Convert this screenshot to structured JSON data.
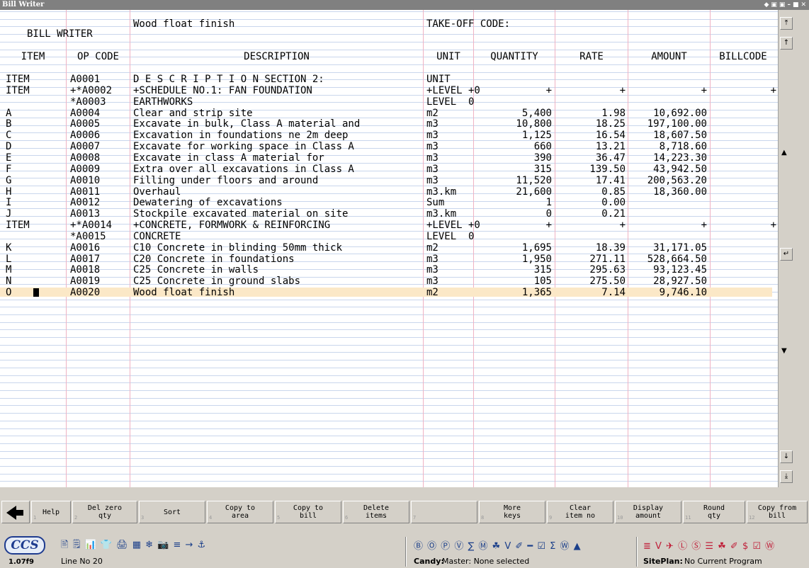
{
  "window": {
    "title": "Bill Writer",
    "controls": [
      "◆",
      "▣",
      "▣",
      "–",
      "■",
      "✕"
    ]
  },
  "sheet": {
    "app_label": "BILL WRITER",
    "current_description": "Wood float finish",
    "takeoff_label": "TAKE-OFF CODE:",
    "columns": [
      "ITEM",
      "OP CODE",
      "DESCRIPTION",
      "UNIT",
      "QUANTITY",
      "RATE",
      "AMOUNT",
      "BILLCODE"
    ],
    "rows": [
      {
        "item": "ITEM",
        "op": "A0001",
        "desc": "D E S C R I P T I O N SECTION 2:",
        "unit": "UNIT",
        "qty": "",
        "rate": "",
        "amount": "",
        "bill": ""
      },
      {
        "item": "ITEM",
        "op": "+*A0002",
        "desc": "+SCHEDULE NO.1: FAN FOUNDATION",
        "unit": "+LEVEL +0",
        "qty": "+",
        "rate": "+",
        "amount": "+",
        "bill": "+"
      },
      {
        "item": "",
        "op": "*A0003",
        "desc": "EARTHWORKS",
        "unit": "LEVEL  0",
        "qty": "",
        "rate": "",
        "amount": "",
        "bill": ""
      },
      {
        "item": "A",
        "op": "A0004",
        "desc": "Clear and strip site",
        "unit": "m2",
        "qty": "5,400",
        "rate": "1.98",
        "amount": "10,692.00",
        "bill": ""
      },
      {
        "item": "B",
        "op": "A0005",
        "desc": "Excavate in bulk, Class A material and",
        "unit": "m3",
        "qty": "10,800",
        "rate": "18.25",
        "amount": "197,100.00",
        "bill": ""
      },
      {
        "item": "C",
        "op": "A0006",
        "desc": "Excavation in foundations ne 2m deep",
        "unit": "m3",
        "qty": "1,125",
        "rate": "16.54",
        "amount": "18,607.50",
        "bill": ""
      },
      {
        "item": "D",
        "op": "A0007",
        "desc": "Excavate for working space in Class A",
        "unit": "m3",
        "qty": "660",
        "rate": "13.21",
        "amount": "8,718.60",
        "bill": ""
      },
      {
        "item": "E",
        "op": "A0008",
        "desc": "Excavate in class A material for",
        "unit": "m3",
        "qty": "390",
        "rate": "36.47",
        "amount": "14,223.30",
        "bill": ""
      },
      {
        "item": "F",
        "op": "A0009",
        "desc": "Extra over all excavations in Class A",
        "unit": "m3",
        "qty": "315",
        "rate": "139.50",
        "amount": "43,942.50",
        "bill": ""
      },
      {
        "item": "G",
        "op": "A0010",
        "desc": "Filling under floors and around",
        "unit": "m3",
        "qty": "11,520",
        "rate": "17.41",
        "amount": "200,563.20",
        "bill": ""
      },
      {
        "item": "H",
        "op": "A0011",
        "desc": "Overhaul",
        "unit": "m3.km",
        "qty": "21,600",
        "rate": "0.85",
        "amount": "18,360.00",
        "bill": ""
      },
      {
        "item": "I",
        "op": "A0012",
        "desc": "Dewatering of excavations",
        "unit": "Sum",
        "qty": "1",
        "rate": "0.00",
        "amount": "",
        "bill": ""
      },
      {
        "item": "J",
        "op": "A0013",
        "desc": "Stockpile excavated material on site",
        "unit": "m3.km",
        "qty": "0",
        "rate": "0.21",
        "amount": "",
        "bill": ""
      },
      {
        "item": "ITEM",
        "op": "+*A0014",
        "desc": "+CONCRETE, FORMWORK & REINFORCING",
        "unit": "+LEVEL +0",
        "qty": "+",
        "rate": "+",
        "amount": "+",
        "bill": "+"
      },
      {
        "item": "",
        "op": "*A0015",
        "desc": "CONCRETE",
        "unit": "LEVEL  0",
        "qty": "",
        "rate": "",
        "amount": "",
        "bill": ""
      },
      {
        "item": "K",
        "op": "A0016",
        "desc": "C10 Concrete in blinding 50mm thick",
        "unit": "m2",
        "qty": "1,695",
        "rate": "18.39",
        "amount": "31,171.05",
        "bill": ""
      },
      {
        "item": "L",
        "op": "A0017",
        "desc": "C20 Concrete in foundations",
        "unit": "m3",
        "qty": "1,950",
        "rate": "271.11",
        "amount": "528,664.50",
        "bill": ""
      },
      {
        "item": "M",
        "op": "A0018",
        "desc": "C25 Concrete in walls",
        "unit": "m3",
        "qty": "315",
        "rate": "295.63",
        "amount": "93,123.45",
        "bill": ""
      },
      {
        "item": "N",
        "op": "A0019",
        "desc": "C25 Concrete in ground slabs",
        "unit": "m3",
        "qty": "105",
        "rate": "275.50",
        "amount": "28,927.50",
        "bill": ""
      },
      {
        "item": "O",
        "op": "A0020",
        "desc": "Wood float finish",
        "unit": "m2",
        "qty": "1,365",
        "rate": "7.14",
        "amount": "9,746.10",
        "bill": "",
        "selected": true
      }
    ]
  },
  "scrollbar": {
    "top_button": "⤒",
    "up_button": "↑",
    "up_small": "▲",
    "return_button": "↵",
    "down_small": "▼",
    "down_button": "↓",
    "bottom_button": "⤓"
  },
  "fkeys": [
    {
      "num": "1",
      "label": "Help"
    },
    {
      "num": "2",
      "label": "Del zero\nqty"
    },
    {
      "num": "3",
      "label": "Sort"
    },
    {
      "num": "4",
      "label": "Copy to\narea"
    },
    {
      "num": "5",
      "label": "Copy to\nbill"
    },
    {
      "num": "6",
      "label": "Delete\nitems"
    },
    {
      "num": "7",
      "label": ""
    },
    {
      "num": "8",
      "label": "More\nkeys"
    },
    {
      "num": "9",
      "label": "Clear\nitem no"
    },
    {
      "num": "10",
      "label": "Display\namount"
    },
    {
      "num": "11",
      "label": "Round\nqty"
    },
    {
      "num": "12",
      "label": "Copy from\nbill"
    }
  ],
  "status": {
    "logo": "CCS",
    "version": "1.07f9",
    "line": "Line No 20",
    "candy": "Candy:",
    "candy_value": "Master: None selected",
    "siteplan": "SitePlan:",
    "siteplan_value": "No Current Program",
    "toolbar1_icons": "🖹 🗒 📊 👕 🖨 ▦ ❄ 📷 ≡ → ⚓",
    "toolbar2_icons": "Ⓑ Ⓞ Ⓟ Ⓥ ∑ Ⓜ ☘ V ✐ ━ ☑ Σ Ⓦ ▲",
    "toolbar3_icons": "≣ V ✈ Ⓛ Ⓢ ☰ ☘ ✐ $ ☑ Ⓦ"
  }
}
